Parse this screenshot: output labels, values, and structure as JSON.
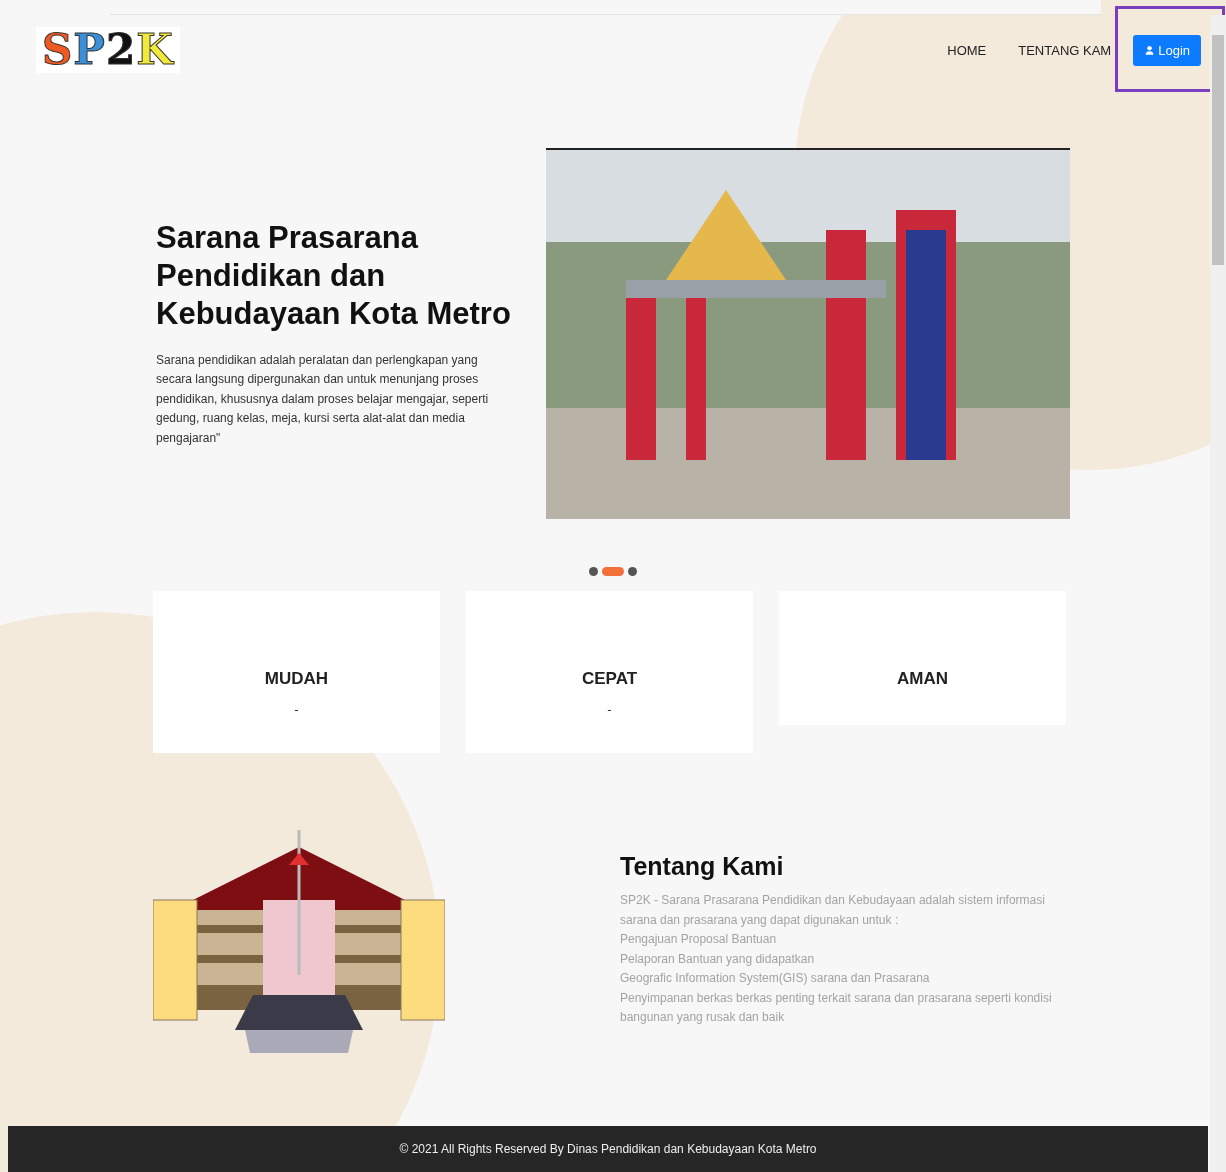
{
  "header": {
    "logo": [
      {
        "char": "S",
        "color": "#f05a22"
      },
      {
        "char": "P",
        "color": "#3b8fd9"
      },
      {
        "char": "2",
        "color": "#111111"
      },
      {
        "char": "K",
        "color": "#f2ea3a"
      }
    ],
    "nav": [
      {
        "label": "HOME"
      },
      {
        "label": "TENTANG KAM"
      }
    ],
    "login_button": {
      "label": "Login"
    }
  },
  "hero": {
    "title": "Sarana Prasarana Pendidikan dan Kebudayaan Kota Metro",
    "text": "Sarana pendidikan adalah peralatan dan perlengkapan yang secara langsung dipergunakan dan untuk menunjang proses pendidikan, khususnya dalam proses belajar mengajar, seperti gedung, ruang kelas, meja, kursi serta alat-alat dan media pengajaran\"",
    "dots": [
      {
        "selected": false
      },
      {
        "selected": true
      },
      {
        "selected": false
      }
    ]
  },
  "features": [
    {
      "title": "MUDAH",
      "text": "-"
    },
    {
      "title": "CEPAT",
      "text": "-"
    },
    {
      "title": "AMAN"
    }
  ],
  "about": {
    "title": "Tentang Kami",
    "lines": [
      "SP2K - Sarana Prasarana Pendidikan dan Kebudayaan adalah sistem informasi sarana dan prasarana yang dapat digunakan untuk :",
      "Pengajuan Proposal Bantuan",
      "Pelaporan Bantuan yang didapatkan",
      "Geografic Information System(GIS) sarana dan Prasarana",
      "Penyimpanan berkas berkas penting terkait sarana dan prasarana seperti kondisi bangunan yang rusak dan baik"
    ]
  },
  "footer": {
    "text": "© 2021 All Rights Reserved By Dinas Pendidikan dan Kebudayaan Kota Metro"
  }
}
